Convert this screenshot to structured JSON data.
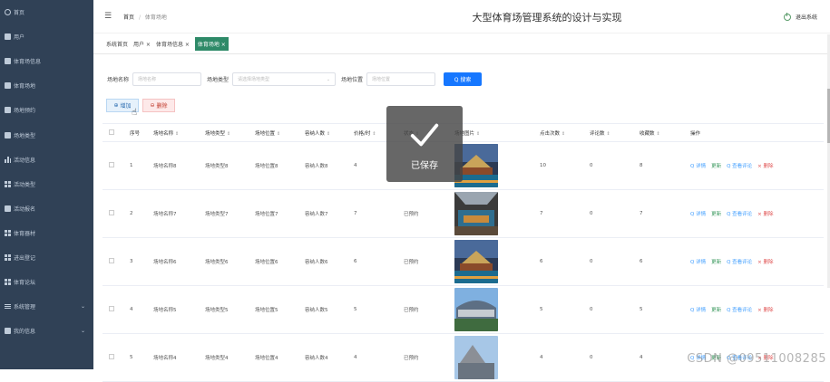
{
  "sidebar": {
    "items": [
      {
        "label": "首页",
        "icon": "home-icon"
      },
      {
        "label": "用户",
        "icon": "user-icon"
      },
      {
        "label": "体育场信息",
        "icon": "stadium-icon"
      },
      {
        "label": "体育场地",
        "icon": "field-icon"
      },
      {
        "label": "场地预约",
        "icon": "booking-icon"
      },
      {
        "label": "场地类型",
        "icon": "type-icon"
      },
      {
        "label": "活动信息",
        "icon": "chart-icon"
      },
      {
        "label": "活动类型",
        "icon": "grid-icon"
      },
      {
        "label": "活动报名",
        "icon": "person-icon"
      },
      {
        "label": "体育器材",
        "icon": "grid-icon"
      },
      {
        "label": "进出登记",
        "icon": "grid-icon"
      },
      {
        "label": "体育论坛",
        "icon": "grid-icon"
      },
      {
        "label": "系统管理",
        "icon": "menu-icon",
        "chevron": "⌄"
      },
      {
        "label": "我的信息",
        "icon": "profile-icon",
        "chevron": "⌄"
      }
    ]
  },
  "header": {
    "breadcrumb_home": "首页",
    "breadcrumb_sep": "/",
    "breadcrumb_current": "体育场地",
    "system_title": "大型体育场管理系统的设计与实现",
    "logout_label": "退出系统"
  },
  "tabs": [
    {
      "label": "系统首页",
      "active": false
    },
    {
      "label": "用户 ×",
      "active": false
    },
    {
      "label": "体育场信息 ×",
      "active": false
    },
    {
      "label": "体育场地 ×",
      "active": true
    }
  ],
  "filters": {
    "name_label": "场地名称",
    "name_placeholder": "场地名称",
    "type_label": "场地类型",
    "type_placeholder": "请选择场地类型",
    "location_label": "场地位置",
    "location_placeholder": "场地位置",
    "search_label": "Q 搜索"
  },
  "actions": {
    "add_label": "增加",
    "delete_label": "删除"
  },
  "table": {
    "headers": [
      "序号",
      "场地名称",
      "场地类型",
      "场地位置",
      "容纳人数",
      "价格/时",
      "状态",
      "场地图片",
      "点击次数",
      "评论数",
      "收藏数",
      "操作"
    ],
    "rows": [
      {
        "idx": "1",
        "name": "场地名称8",
        "type": "场地类型8",
        "location": "场地位置8",
        "capacity": "容纳人数8",
        "price": "4",
        "status": "",
        "clicks": "10",
        "comments": "0",
        "favorites": "8",
        "image": "stadium-night"
      },
      {
        "idx": "2",
        "name": "场地名称7",
        "type": "场地类型7",
        "location": "场地位置7",
        "capacity": "容纳人数7",
        "price": "7",
        "status": "已预约",
        "clicks": "7",
        "comments": "0",
        "favorites": "7",
        "image": "arena-interior"
      },
      {
        "idx": "3",
        "name": "场地名称6",
        "type": "场地类型6",
        "location": "场地位置6",
        "capacity": "容纳人数6",
        "price": "6",
        "status": "已预约",
        "clicks": "6",
        "comments": "0",
        "favorites": "6",
        "image": "stadium-night"
      },
      {
        "idx": "4",
        "name": "场地名称5",
        "type": "场地类型5",
        "location": "场地位置5",
        "capacity": "容纳人数5",
        "price": "5",
        "status": "已预约",
        "clicks": "5",
        "comments": "0",
        "favorites": "5",
        "image": "stadium-exterior"
      },
      {
        "idx": "5",
        "name": "场地名称4",
        "type": "场地类型4",
        "location": "场地位置4",
        "capacity": "容纳人数4",
        "price": "4",
        "status": "已预约",
        "clicks": "4",
        "comments": "0",
        "favorites": "4",
        "image": "stadium-sky"
      }
    ],
    "ops": {
      "detail": "Q 详情",
      "update": "更新",
      "comment": "Q 查看评论",
      "delete": "× 删除"
    }
  },
  "toast": {
    "message": "已保存"
  },
  "watermark": "CSDN @09511008285",
  "colors": {
    "sidebar": "#304156",
    "active_tab": "#2e8a68",
    "search_button": "#1677ff"
  }
}
